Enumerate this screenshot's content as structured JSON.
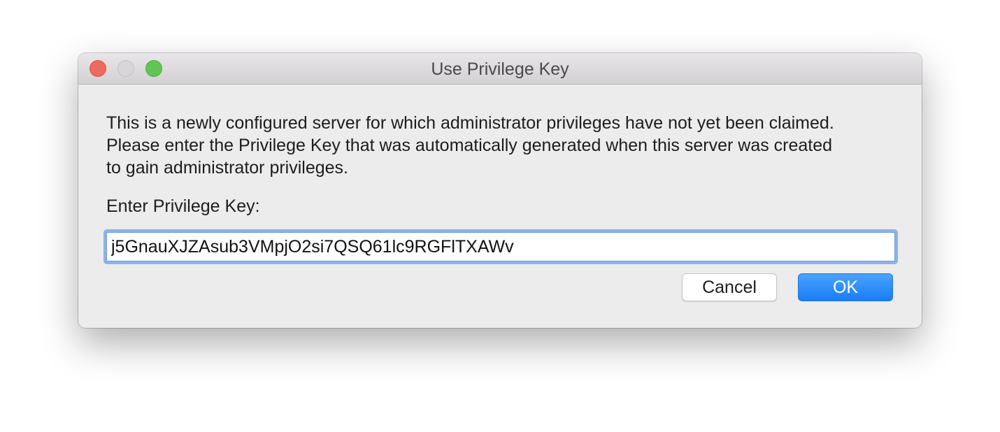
{
  "window": {
    "title": "Use Privilege Key"
  },
  "traffic_lights": {
    "close_color": "#ed6a5e",
    "minimize_color": "#d8d6d8",
    "zoom_color": "#61c554"
  },
  "dialog": {
    "message_lines": [
      "This is a newly configured server for which administrator privileges have not yet been claimed.",
      "Please enter the Privilege Key that was automatically generated when this server was created",
      "to gain administrator privileges."
    ],
    "key_label": "Enter Privilege Key:",
    "key_value": "j5GnauXJZAsub3VMpjO2si7QSQ61lc9RGFlTXAWv"
  },
  "buttons": {
    "cancel_label": "Cancel",
    "ok_label": "OK",
    "ok_color": "#1a7cf5"
  }
}
